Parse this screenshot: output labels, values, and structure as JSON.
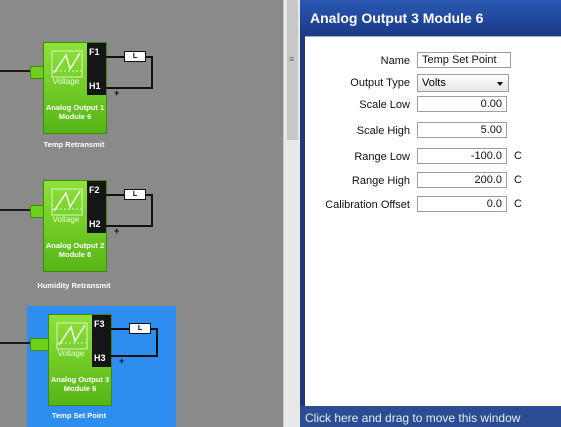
{
  "modules": [
    {
      "terminal_top": "F1",
      "terminal_bottom": "H1",
      "type_label": "Voltage",
      "name_line1": "Analog Output 1",
      "name_line2": "Module 6",
      "caption": "Temp Retransmit",
      "led": "L",
      "selected": false
    },
    {
      "terminal_top": "F2",
      "terminal_bottom": "H2",
      "type_label": "Voltage",
      "name_line1": "Analog Output 2",
      "name_line2": "Module 6",
      "caption": "Humidity Retransmit",
      "led": "L",
      "selected": false
    },
    {
      "terminal_top": "F3",
      "terminal_bottom": "H3",
      "type_label": "Voltage",
      "name_line1": "Analog Output 3",
      "name_line2": "Module 6",
      "caption": "Temp Set Point",
      "led": "L",
      "selected": true
    }
  ],
  "panel": {
    "title": "Analog Output 3 Module 6",
    "fields": {
      "name_label": "Name",
      "name_value": "Temp Set Point",
      "output_type_label": "Output Type",
      "output_type_value": "Volts",
      "scale_low_label": "Scale Low",
      "scale_low_value": "0.00",
      "scale_high_label": "Scale High",
      "scale_high_value": "5.00",
      "range_low_label": "Range Low",
      "range_low_value": "-100.0",
      "range_low_unit": "C",
      "range_high_label": "Range High",
      "range_high_value": "200.0",
      "range_high_unit": "C",
      "cal_offset_label": "Calibration Offset",
      "cal_offset_value": "0.0",
      "cal_offset_unit": "C"
    },
    "footer_text": "Click here and drag to move this window"
  },
  "splitter_grip": "≡",
  "colors": {
    "module_green": "#6fcf1d",
    "selected_blue": "#2d8ef0",
    "panel_blue": "#1d3a78",
    "canvas_gray": "#8a8a8a"
  }
}
